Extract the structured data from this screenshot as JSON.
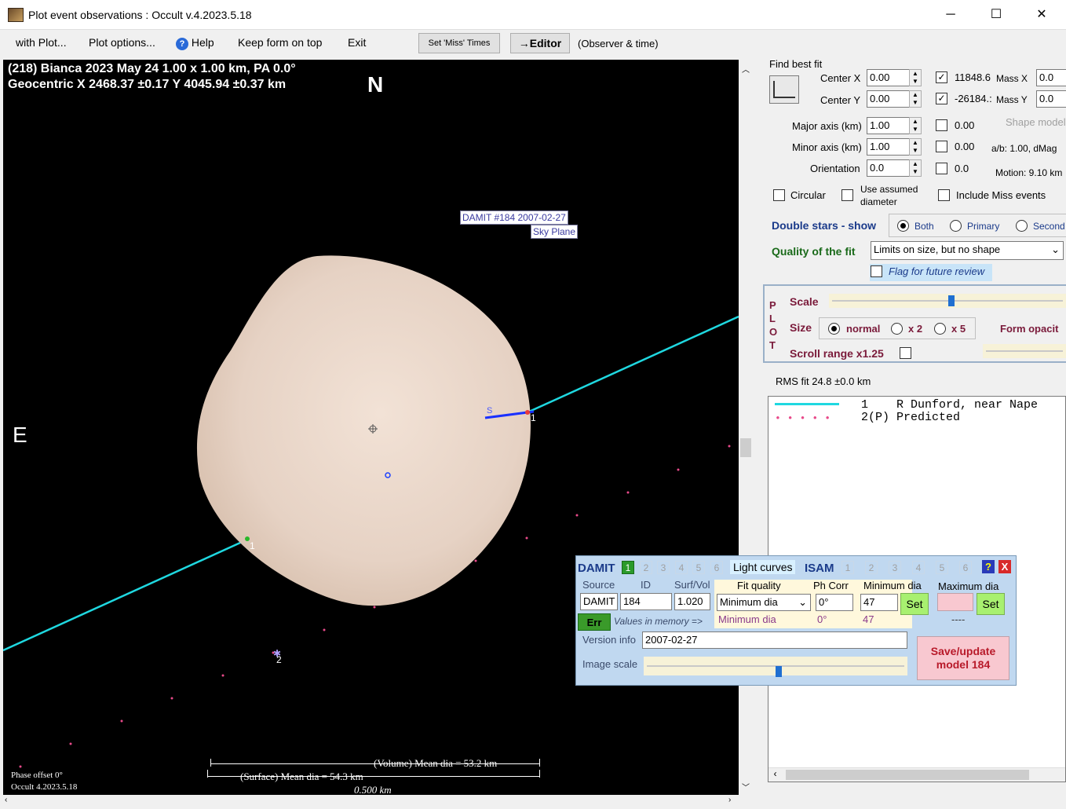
{
  "window": {
    "title": "Plot event observations : Occult v.4.2023.5.18",
    "minimize": "─",
    "maximize": "☐",
    "close": "✕"
  },
  "menu": {
    "with_plot": "with Plot...",
    "plot_options": "Plot options...",
    "help": "Help",
    "keep_on_top": "Keep form on top",
    "exit": "Exit",
    "set_miss": "Set 'Miss' Times",
    "editor": "→Editor",
    "observer_time": "(Observer & time)"
  },
  "plot": {
    "header1": "(218) Bianca  2023 May 24   1.00 x 1.00 km, PA 0.0°",
    "header2": "Geocentric  X  2468.37 ±0.17  Y 4045.94 ±0.37 km",
    "north": "N",
    "east": "E",
    "damit_label1": "DAMIT #184 2007-02-27",
    "damit_label2": "Sky Plane",
    "chord1": "1",
    "chord1b": "1",
    "chord2": "2",
    "chord_s": "S",
    "volume_dia": "(Volume) Mean dia = 53.2 km",
    "surface_dia": "(Surface) Mean dia = 54.3 km",
    "scale_bar": "0.500 km",
    "phase_offset": "Phase offset 0°",
    "version": "Occult 4.2023.5.18",
    "colors": {
      "chord": "#1fd8e0",
      "shape": "#e8d6c8",
      "predicted": "#e84a8a"
    }
  },
  "fit": {
    "title": "Find best fit",
    "center_x_label": "Center X",
    "center_x": "0.00",
    "center_y_label": "Center Y",
    "center_y": "0.00",
    "major_label": "Major axis (km)",
    "major": "1.00",
    "minor_label": "Minor axis (km)",
    "minor": "1.00",
    "orient_label": "Orientation",
    "orient": "0.0",
    "mass_x_val": "11848.6",
    "mass_x_label": "Mass X",
    "mass_x": "0.0",
    "mass_y_val": "-26184.:",
    "mass_y_label": "Mass Y",
    "mass_y": "0.0",
    "cb_major": "0.00",
    "cb_minor": "0.00",
    "cb_orient": "0.0",
    "shape_model": "Shape model",
    "ab": "a/b: 1.00, dMag",
    "motion": "Motion: 9.10 km",
    "circular": "Circular",
    "use_assumed": "Use assumed",
    "diameter": "diameter",
    "include_miss": "Include Miss events",
    "double_stars": "Double stars - show",
    "both": "Both",
    "primary": "Primary",
    "secondary": "Second",
    "quality_label": "Quality of the fit",
    "quality_value": "Limits on size, but no shape",
    "flag_review": "Flag for future review"
  },
  "plotbox": {
    "vertical": [
      "P",
      "L",
      "O",
      "T"
    ],
    "scale": "Scale",
    "size": "Size",
    "normal": "normal",
    "x2": "x 2",
    "x5": "x 5",
    "form_opacity": "Form opacit",
    "scroll_range": "Scroll range x1.25"
  },
  "rms": "RMS fit 24.8 ±0.0 km",
  "observers": [
    {
      "num": "1",
      "name": "R Dunford, near Nape"
    },
    {
      "num": "2(P)",
      "name": "Predicted"
    }
  ],
  "damit": {
    "title": "DAMIT",
    "nums": [
      "1",
      "2",
      "3",
      "4",
      "5",
      "6"
    ],
    "light_curves": "Light curves",
    "isam": "ISAM",
    "isam_nums": [
      "1",
      "2",
      "3",
      "4",
      "5",
      "6"
    ],
    "help": "?",
    "close": "X",
    "source_label": "Source",
    "source": "DAMIT",
    "id_label": "ID",
    "id": "184",
    "surf_label": "Surf/Vol",
    "surf": "1.020",
    "fit_quality_label": "Fit quality",
    "fit_quality": "Minimum dia",
    "fit_quality_mem": "Minimum dia",
    "ph_corr_label": "Ph Corr",
    "ph_corr": "0°",
    "ph_corr_mem": "0°",
    "min_dia_label": "Minimum dia",
    "min_dia": "47",
    "min_dia_mem": "47",
    "max_dia_label": "Maximum dia",
    "max_dia_mem": "----",
    "set": "Set",
    "err": "Err",
    "values_in_memory": "Values in memory =>",
    "version_label": "Version info",
    "version": "2007-02-27",
    "image_scale": "Image scale",
    "save1": "Save/update",
    "save2": "model 184"
  }
}
